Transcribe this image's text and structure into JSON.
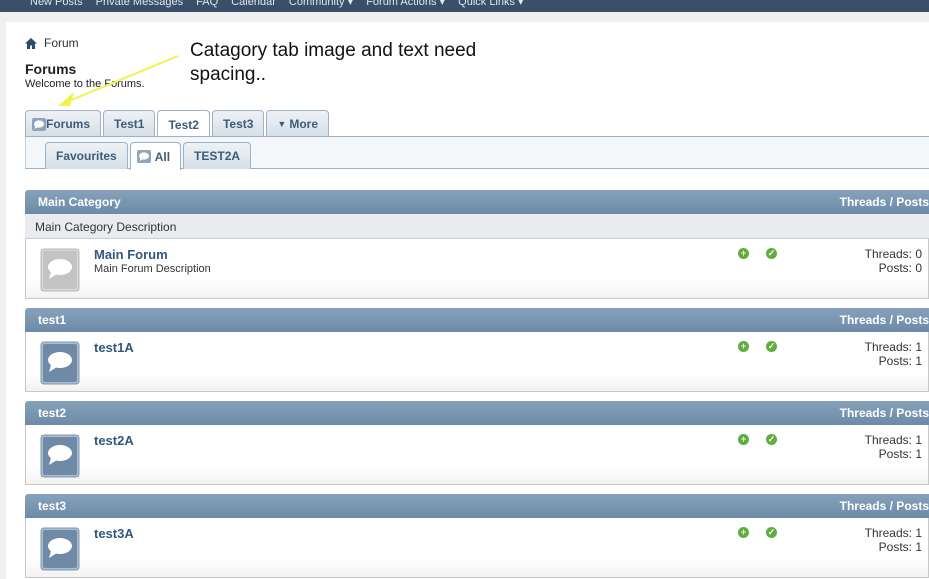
{
  "topnav": {
    "links": [
      "New Posts",
      "Private Messages",
      "FAQ",
      "Calendar",
      "Community ▾",
      "Forum Actions ▾",
      "Quick Links ▾"
    ]
  },
  "breadcrumb": {
    "label": "Forum"
  },
  "header": {
    "title": "Forums",
    "welcome": "Welcome to the Forums."
  },
  "annotation": {
    "text_line1": "Catagory tab image and text need",
    "text_line2": "spacing.."
  },
  "tabs": [
    {
      "label": "Forums",
      "icon": "speech-bubble-icon",
      "active": false
    },
    {
      "label": "Test1",
      "active": false
    },
    {
      "label": "Test2",
      "active": true
    },
    {
      "label": "Test3",
      "active": false
    },
    {
      "label": "More",
      "icon": "chevron-down-icon",
      "active": false
    }
  ],
  "subtabs": [
    {
      "label": "Favourites",
      "active": false
    },
    {
      "label": "All",
      "icon": "speech-bubble-icon",
      "active": true
    },
    {
      "label": "TEST2A",
      "active": false
    }
  ],
  "categories": [
    {
      "title": "Main Category",
      "right": "Threads / Posts",
      "description": "Main Category Description",
      "forum": {
        "name": "Main Forum",
        "description": "Main Forum Description",
        "threads": "Threads: 0",
        "posts": "Posts: 0"
      }
    },
    {
      "title": "test1",
      "right": "Threads / Posts",
      "forum": {
        "name": "test1A",
        "threads": "Threads: 1",
        "posts": "Posts: 1"
      }
    },
    {
      "title": "test2",
      "right": "Threads / Posts",
      "forum": {
        "name": "test2A",
        "threads": "Threads: 1",
        "posts": "Posts: 1"
      }
    },
    {
      "title": "test3",
      "right": "Threads / Posts",
      "forum": {
        "name": "test3A",
        "threads": "Threads: 1",
        "posts": "Posts: 1"
      }
    }
  ],
  "colors": {
    "header": "#6c8ba7",
    "link": "#33587f",
    "annotation_arrow": "#f2f24a",
    "status_green": "#5fae3c"
  }
}
